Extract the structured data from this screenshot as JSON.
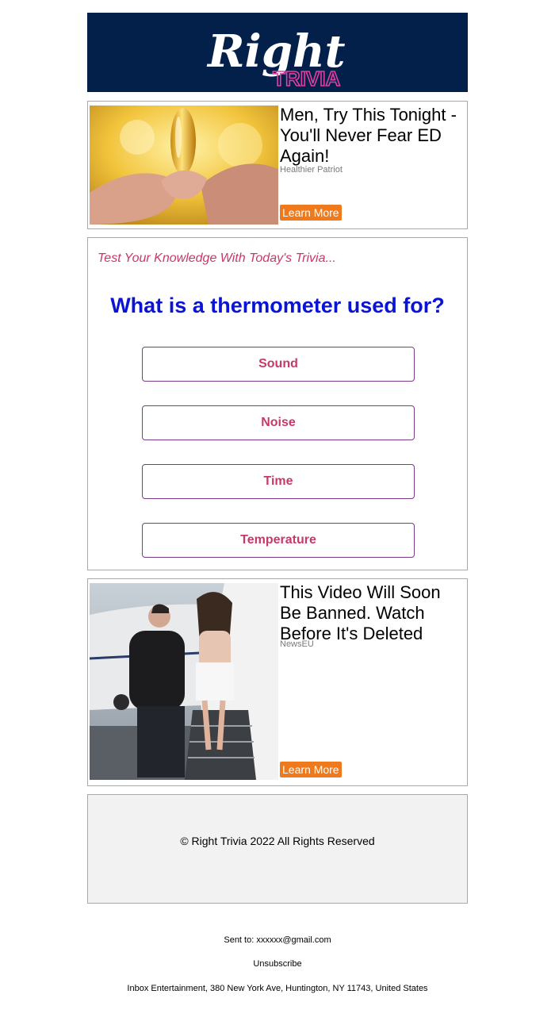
{
  "header": {
    "logo_word": "Right",
    "logo_sub": "TRIVIA"
  },
  "ads": [
    {
      "title": "Men, Try This Tonight - You'll Never Fear ED Again!",
      "source": "Healthier Patriot",
      "button": "Learn More"
    },
    {
      "title": "This Video Will Soon Be Banned. Watch Before It's Deleted",
      "source": "NewsEU",
      "button": "Learn More"
    }
  ],
  "trivia": {
    "tagline": "Test Your Knowledge With Today's Trivia...",
    "question": "What is a thermometer used for?",
    "answers": [
      "Sound",
      "Noise",
      "Time",
      "Temperature"
    ]
  },
  "footer": {
    "copyright": "© Right Trivia 2022 All Rights Reserved"
  },
  "meta": {
    "sent_label": "Sent to:",
    "sent_email": "xxxxxx@gmail.com",
    "unsubscribe": "Unsubscribe",
    "address": "Inbox Entertainment, 380 New York Ave, Huntington, NY 11743, United States"
  },
  "colors": {
    "header_bg": "#03204a",
    "button_orange": "#ee7a1d",
    "question_blue": "#0a14d4",
    "accent_pink": "#c8386a"
  }
}
